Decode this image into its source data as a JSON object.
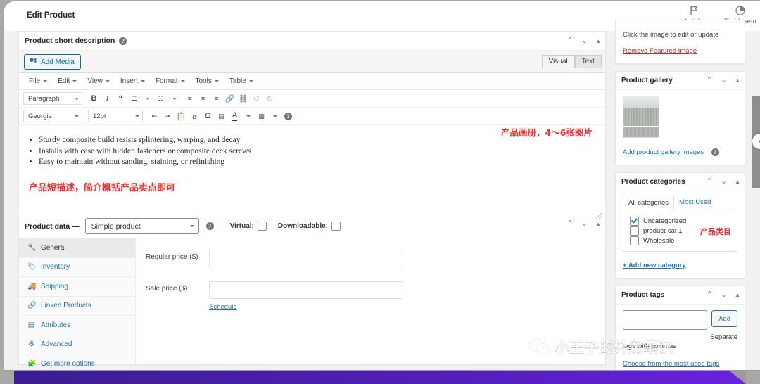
{
  "window": {
    "title": "Edit Product",
    "actions": [
      {
        "label": "Activity",
        "icon": "flag-icon"
      },
      {
        "label": "Finish setu",
        "icon": "clock-progress-icon"
      }
    ]
  },
  "short_description": {
    "title": "Product short description",
    "help_icon": "help-icon",
    "add_media": "Add Media",
    "editor_tabs": [
      {
        "label": "Visual",
        "active": true
      },
      {
        "label": "Text",
        "active": false
      }
    ],
    "menu": [
      "File",
      "Edit",
      "View",
      "Insert",
      "Format",
      "Tools",
      "Table"
    ],
    "toolbar_row1": {
      "paragraph_style": "Paragraph",
      "buttons": [
        "bold",
        "italic",
        "blockquote",
        "bulleted-list",
        "numbered-list",
        "align-left",
        "align-center",
        "align-right",
        "link",
        "unlink",
        "undo",
        "redo"
      ]
    },
    "toolbar_row2": {
      "font_family": "Georgia",
      "font_size": "12pt",
      "buttons": [
        "decrease-indent",
        "increase-indent",
        "paste-as-text",
        "clear-formatting",
        "special-character",
        "horizontal-line",
        "text-color",
        "table",
        "keyboard-shortcuts"
      ]
    },
    "bullets": [
      "Sturdy composite build resists splintering, warping, and decay",
      "Installs with ease with hidden fasteners or composite deck screws",
      "Easy to maintain without sanding, staining, or refinishing"
    ],
    "annotation": "产品短描述，简介概括产品卖点即可",
    "gallery_annotation": "产品画册，4～6张图片"
  },
  "product_data": {
    "title": "Product data —",
    "product_type": "Simple product",
    "help_icon": "help-icon",
    "virtual_label": "Virtual:",
    "downloadable_label": "Downloadable:",
    "tabs": [
      {
        "label": "General",
        "icon": "wrench-icon",
        "active": true
      },
      {
        "label": "Inventory",
        "icon": "tag-icon",
        "active": false
      },
      {
        "label": "Shipping",
        "icon": "truck-icon",
        "active": false
      },
      {
        "label": "Linked Products",
        "icon": "link-icon",
        "active": false
      },
      {
        "label": "Attributes",
        "icon": "list-icon",
        "active": false
      },
      {
        "label": "Advanced",
        "icon": "gear-icon",
        "active": false
      },
      {
        "label": "Get more options",
        "icon": "extension-icon",
        "active": false
      }
    ],
    "fields": [
      {
        "label": "Regular price ($)",
        "value": ""
      },
      {
        "label": "Sale price ($)",
        "value": ""
      }
    ],
    "schedule_link": "Schedule"
  },
  "sidebar": {
    "featured_image": {
      "hint": "Click the image to edit or update",
      "remove_link": "Remove Featured Image"
    },
    "gallery": {
      "title": "Product gallery",
      "add_link": "Add product gallery images",
      "help_icon": "help-icon"
    },
    "categories": {
      "title": "Product categories",
      "tabs": [
        {
          "label": "All categories",
          "active": true
        },
        {
          "label": "Most Used",
          "active": false
        }
      ],
      "items": [
        {
          "label": "Uncategorized",
          "checked": true
        },
        {
          "label": "product-cat 1",
          "checked": false
        },
        {
          "label": "Wholesale",
          "checked": false
        }
      ],
      "add_link": "+ Add new category",
      "annotation": "产品类目"
    },
    "tags": {
      "title": "Product tags",
      "input_value": "",
      "add_button": "Add",
      "hint": "Separate",
      "hint2": "tags with commas",
      "most_used_link": "Choose from the most used tags"
    }
  },
  "watermark": {
    "text": "小王子的外贸笔记",
    "icon": "wechat-icon"
  },
  "colors": {
    "accent_blue": "#2271b1",
    "annotation_red": "#ec2f2f",
    "purple_bar": "#5b20c8"
  }
}
